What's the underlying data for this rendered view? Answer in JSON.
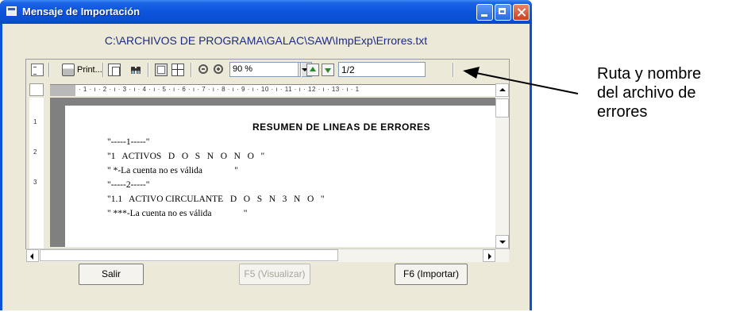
{
  "window": {
    "title": "Mensaje de Importación"
  },
  "file_path": "C:\\ARCHIVOS DE PROGRAMA\\GALAC\\SAW\\ImpExp\\Errores.txt",
  "toolbar": {
    "print_label": "Print...",
    "zoom_value": "90 %",
    "page_value": "1/2"
  },
  "ruler": {
    "h_marks": "· 1 · ı · 2 · ı · 3 · ı · 4 · ı · 5 · ı · 6 · ı · 7 · ı · 8 · ı · 9 · ı · 10 · ı · 11 · ı · 12 · ı · 13 · ı · 1",
    "v_marks": [
      "1",
      "2",
      "3"
    ]
  },
  "report": {
    "title": "RESUMEN DE LINEAS DE ERRORES",
    "lines": [
      "\"-----1-----\"",
      "\"1   ACTIVOS   D   O   S   N   O   N   O   \"",
      "\" *-La cuenta no es válida              \"",
      "\"-----2-----\"",
      "\"1.1   ACTIVO CIRCULANTE   D   O   S   N   3   N   O   \"",
      "\" ***-La cuenta no es válida              \""
    ]
  },
  "buttons": {
    "exit": "Salir",
    "view": "F5 (Visualizar)",
    "import": "F6 (Importar)"
  },
  "annotation": {
    "lines": [
      "Ruta y nombre",
      "del archivo de",
      "errores"
    ]
  }
}
